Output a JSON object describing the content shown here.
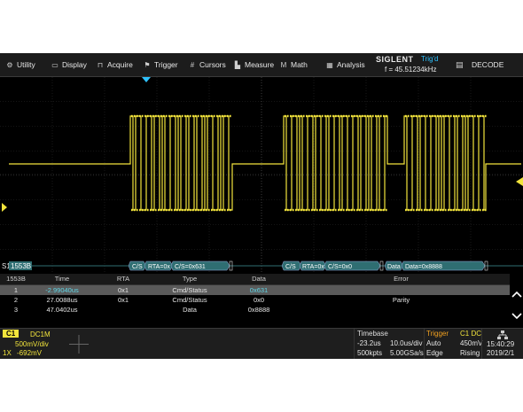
{
  "menu": {
    "items": [
      {
        "name": "utility",
        "label": "Utility",
        "icon": "⚙"
      },
      {
        "name": "display",
        "label": "Display",
        "icon": "▭"
      },
      {
        "name": "acquire",
        "label": "Acquire",
        "icon": "⊓"
      },
      {
        "name": "trigger",
        "label": "Trigger",
        "icon": "⚑"
      },
      {
        "name": "cursors",
        "label": "Cursors",
        "icon": "#"
      },
      {
        "name": "measure",
        "label": "Measure",
        "icon": "▙"
      },
      {
        "name": "math",
        "label": "Math",
        "icon": "M"
      },
      {
        "name": "analysis",
        "label": "Analysis",
        "icon": "▦"
      }
    ],
    "brand": "SIGLENT",
    "trig_status": "Trig'd",
    "frequency": "f = 45.51234kHz",
    "decode_label": "DECODE",
    "decode_icon": "▤"
  },
  "bus": {
    "label": "S1",
    "protocol": "1553B",
    "frame1": {
      "cs": "C/S",
      "rta": "RTA=0x",
      "cs_value": "C/S=0x631"
    },
    "frame2": {
      "cs": "C/S",
      "rta": "RTA=0x",
      "cs_value": "C/S=0x0"
    },
    "frame3": {
      "data": "Data",
      "data_value": "Data=0x8888"
    }
  },
  "table": {
    "headers": [
      "1553B",
      "Time",
      "RTA",
      "Type",
      "Data",
      "Error"
    ],
    "rows": [
      {
        "index": "1",
        "time": "-2.99040us",
        "rta": "0x1",
        "type": "Cmd/Status",
        "data": "0x631",
        "error": ""
      },
      {
        "index": "2",
        "time": "27.0088us",
        "rta": "0x1",
        "type": "Cmd/Status",
        "data": "0x0",
        "error": "Parity"
      },
      {
        "index": "3",
        "time": "47.0402us",
        "rta": "",
        "type": "Data",
        "data": "0x8888",
        "error": ""
      }
    ]
  },
  "status": {
    "channel": "C1",
    "coupling": "DC1M",
    "volts_div": "500mV/div",
    "probe": "1X",
    "offset": "-692mV",
    "timebase_title": "Timebase",
    "delay": "-23.2us",
    "time_div": "10.0us/div",
    "points": "500kpts",
    "sample_rate": "5.00GSa/s",
    "trigger_title": "Trigger",
    "trigger_source": "C1 DC",
    "trigger_mode": "Auto",
    "trigger_level": "450mV",
    "trigger_type": "Edge",
    "trigger_slope": "Rising",
    "time": "15:40:29",
    "date": "2019/2/1"
  },
  "colors": {
    "channel1": "#f2e43c",
    "bus_fill": "#2f6e72",
    "accent": "#2ec2ff",
    "trigger_title": "#f0a020"
  }
}
